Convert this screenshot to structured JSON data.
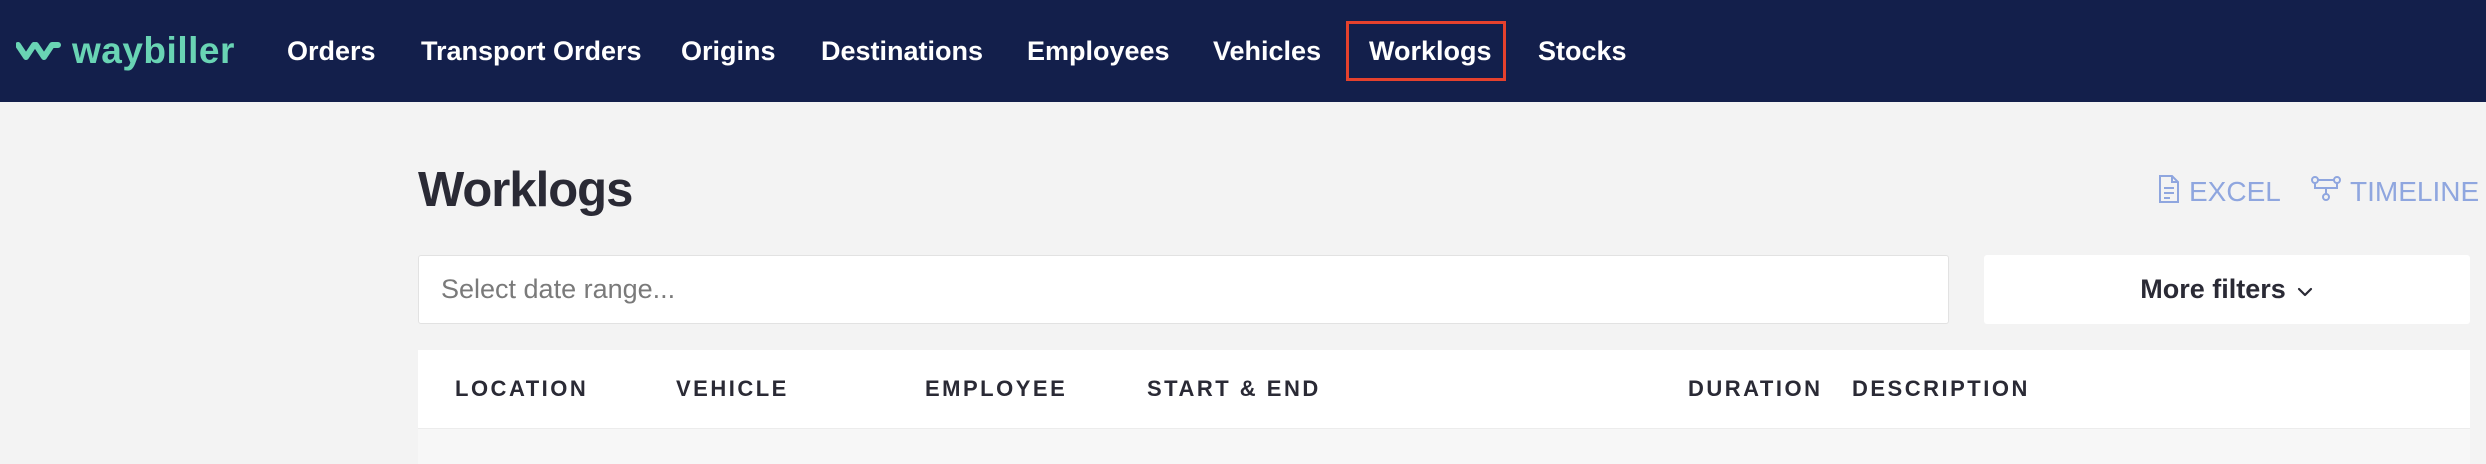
{
  "app": {
    "logo_text": "waybiller"
  },
  "nav": {
    "items": [
      {
        "label": "Orders"
      },
      {
        "label": "Transport Orders"
      },
      {
        "label": "Origins"
      },
      {
        "label": "Destinations"
      },
      {
        "label": "Employees"
      },
      {
        "label": "Vehicles"
      },
      {
        "label": "Worklogs",
        "active": true
      },
      {
        "label": "Stocks"
      }
    ]
  },
  "page": {
    "title": "Worklogs",
    "actions": {
      "excel_label": "EXCEL",
      "timeline_label": "TIMELINE"
    }
  },
  "filters": {
    "date_range_placeholder": "Select date range...",
    "date_range_value": "",
    "more_filters_label": "More filters"
  },
  "table": {
    "columns": [
      "LOCATION",
      "VEHICLE",
      "EMPLOYEE",
      "START & END",
      "DURATION",
      "DESCRIPTION"
    ]
  },
  "colors": {
    "nav_background": "#131f4b",
    "brand_accent": "#69d4b4",
    "active_outline": "#e5412d",
    "action_link": "#8fa6df",
    "page_background": "#f3f3f3"
  },
  "icons": {
    "logo": "waybiller-logo-icon",
    "excel": "excel-file-icon",
    "timeline": "timeline-icon",
    "dropdown": "chevron-down-icon"
  }
}
